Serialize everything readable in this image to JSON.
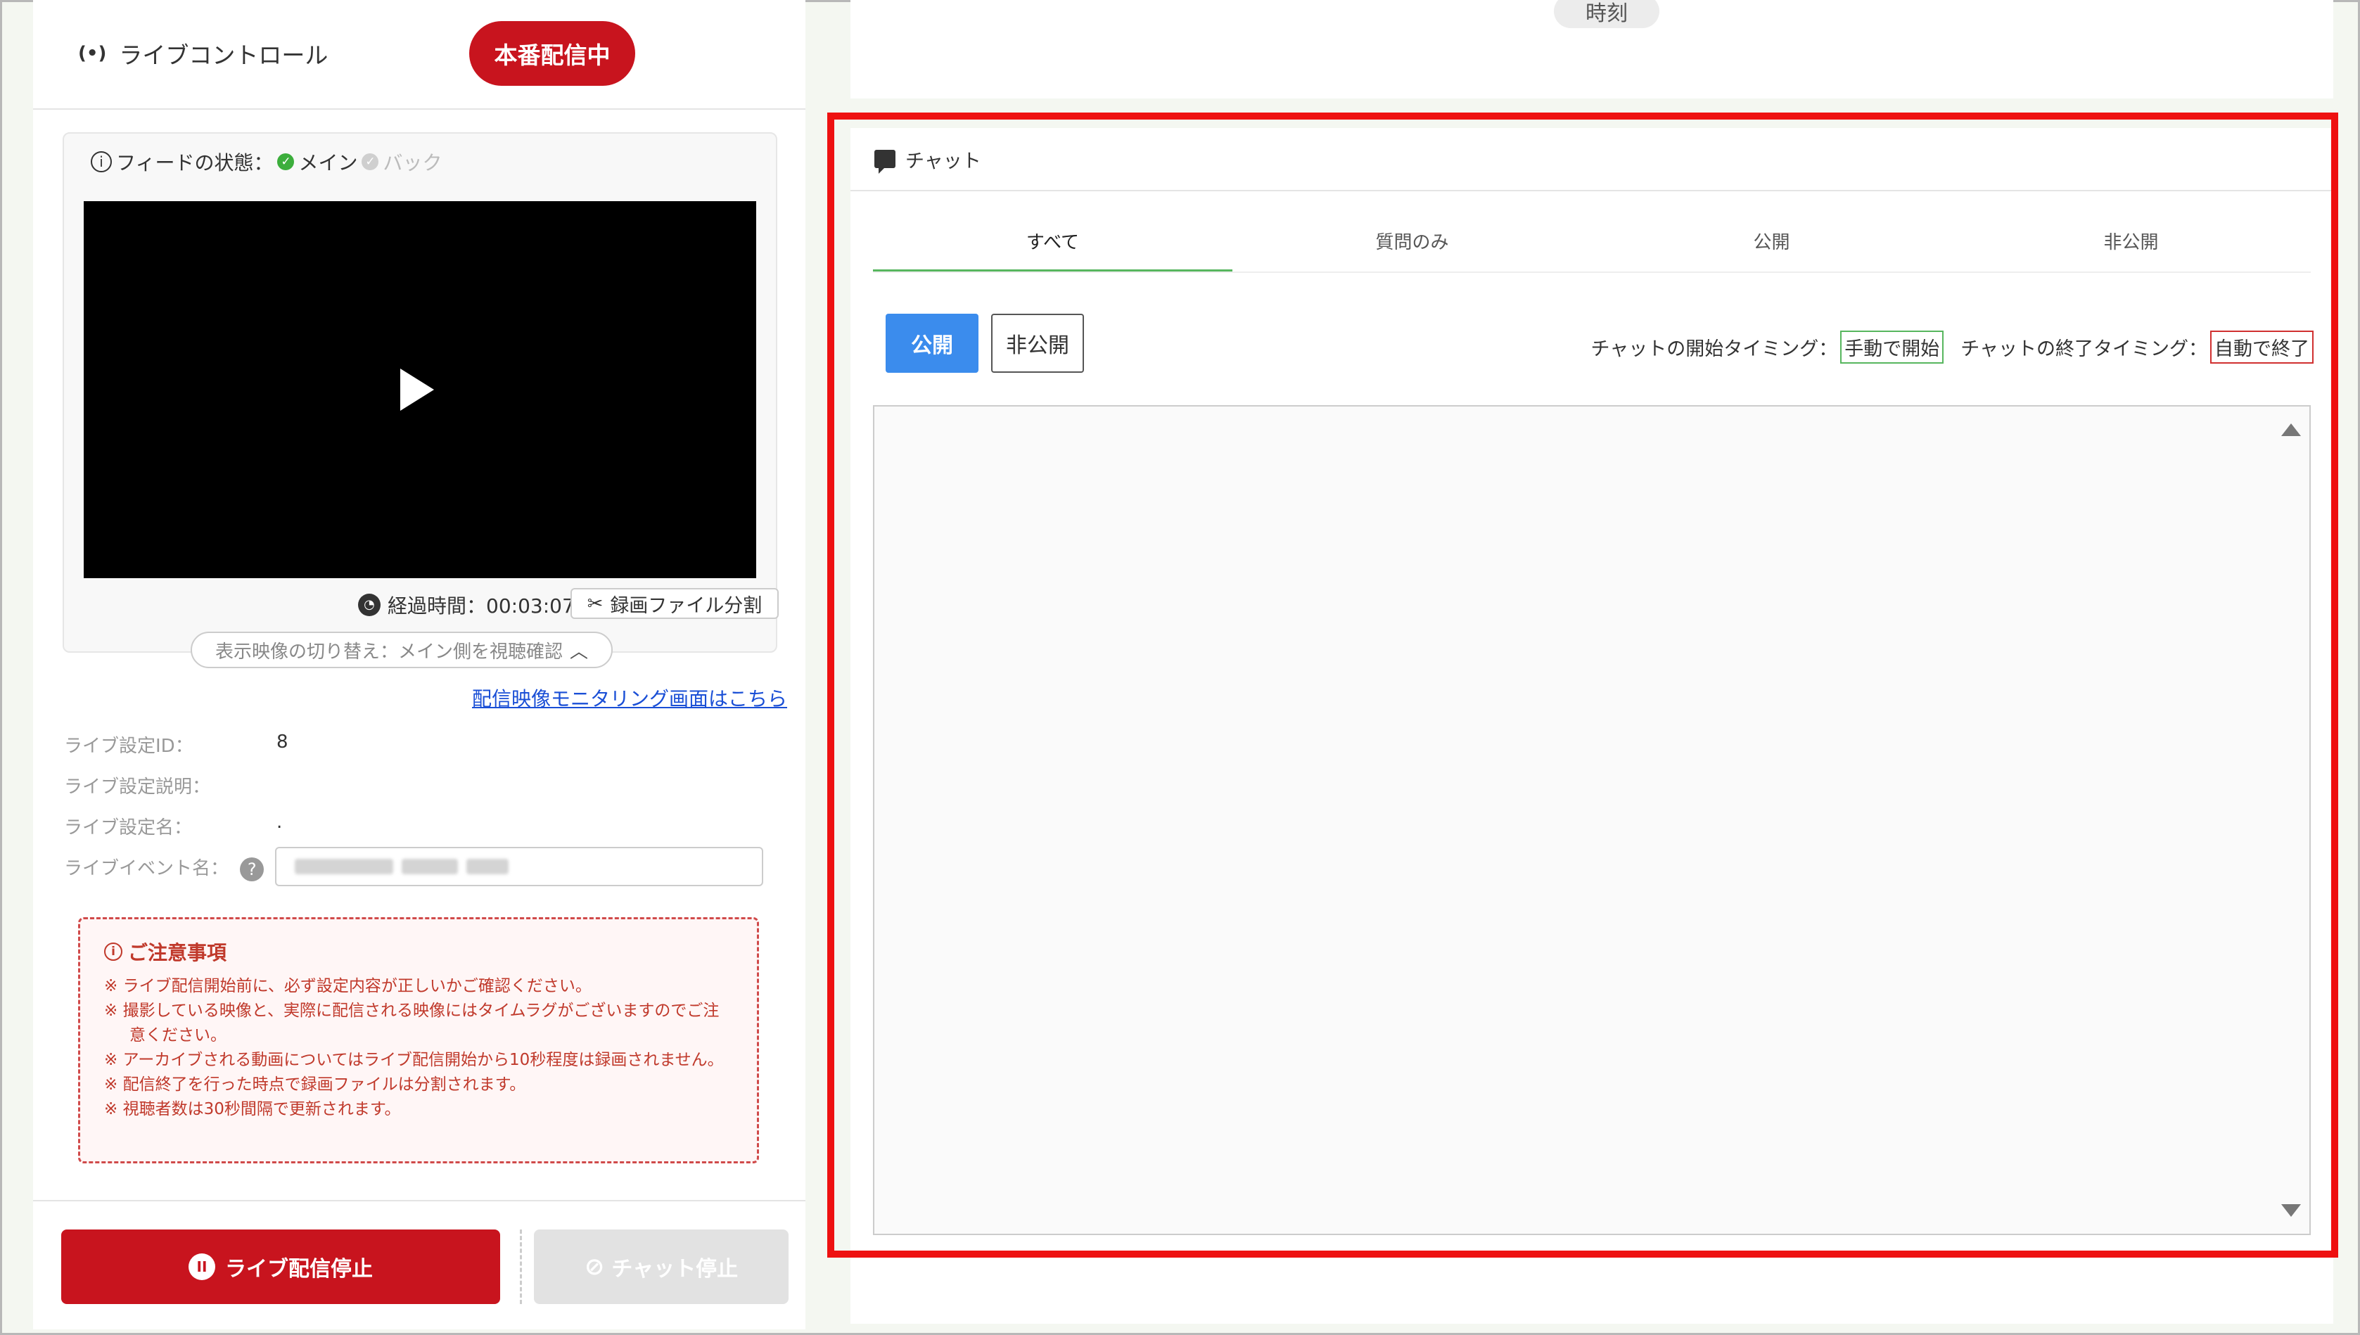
{
  "live_control": {
    "title": "ライブコントロール",
    "onair_badge": "本番配信中"
  },
  "feed": {
    "status_label": "フィードの状態：",
    "main": "メイン",
    "back": "バック",
    "elapsed_label": "経過時間：00:03:07",
    "split_button": "録画ファイル分割",
    "switch_toggle": "表示映像の切り替え：メイン側を視聴確認"
  },
  "monitor_link": "配信映像モニタリング画面はこちら",
  "settings": {
    "id_label": "ライブ設定ID：",
    "id_value": "8",
    "desc_label": "ライブ設定説明：",
    "name_label": "ライブ設定名：",
    "name_value": ".",
    "event_label": "ライブイベント名："
  },
  "notice": {
    "title": "ご注意事項",
    "items": [
      "※  ライブ配信開始前に、必ず設定内容が正しいかご確認ください。",
      "※  撮影している映像と、実際に配信される映像にはタイムラグがございますのでご注意ください。",
      "※  アーカイブされる動画についてはライブ配信開始から10秒程度は録画されません。",
      "※  配信終了を行った時点で録画ファイルは分割されます。",
      "※  視聴者数は30秒間隔で更新されます。"
    ]
  },
  "footer": {
    "stop_live": "ライブ配信停止",
    "stop_chat": "チャット停止"
  },
  "top": {
    "time_label": "時刻"
  },
  "chat": {
    "header": "チャット",
    "tabs": [
      "すべて",
      "質問のみ",
      "公開",
      "非公開"
    ],
    "public_button": "公開",
    "private_button": "非公開",
    "start_timing_label": "チャットの開始タイミング：",
    "start_timing_value": "手動で開始",
    "end_timing_label": "チャットの終了タイミング：",
    "end_timing_value": "自動で終了"
  },
  "colors": {
    "accent_red": "#c8141e",
    "accent_blue": "#3b8ced",
    "tab_green": "#57b65e",
    "highlight_red": "#ee1111"
  }
}
